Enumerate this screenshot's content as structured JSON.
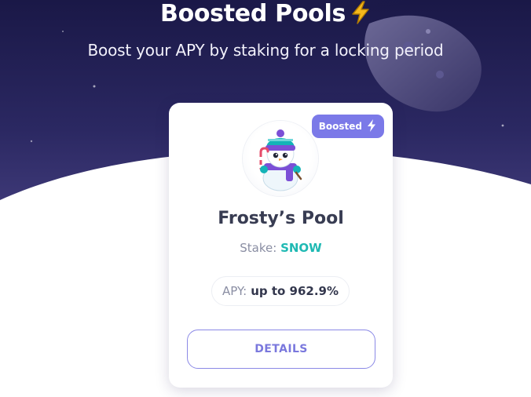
{
  "hero": {
    "title": "Boosted Pools",
    "title_icon": "lightning-bolt-icon",
    "subtitle": "Boost your APY by staking for a locking period"
  },
  "pool": {
    "badge": "Boosted",
    "badge_icon": "lightning-bolt-icon",
    "avatar": "snowman-mascot",
    "name": "Frosty’s Pool",
    "stake_label": "Stake:",
    "stake_token": "SNOW",
    "apy_label": "APY:",
    "apy_value": "up to 962.9%",
    "details_label": "DETAILS"
  },
  "colors": {
    "hero_dark": "#1e1b4b",
    "hero_mid": "#34306d",
    "accent": "#7b79e8",
    "token": "#1fb9b3",
    "bolt": "#f5b81c"
  }
}
